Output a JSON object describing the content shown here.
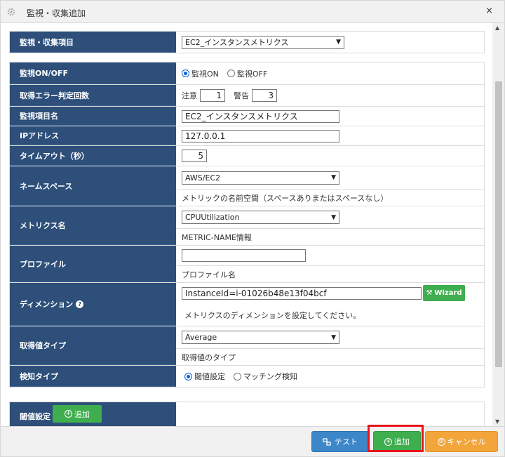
{
  "window": {
    "title": "監視・収集追加",
    "close_glyph": "×"
  },
  "fields": {
    "monitor_item": {
      "label": "監視・収集項目",
      "value": "EC2_インスタンスメトリクス"
    },
    "monitor_onoff": {
      "label": "監視ON/OFF",
      "on_label": "監視ON",
      "off_label": "監視OFF",
      "selected": "on"
    },
    "error_count": {
      "label": "取得エラー判定回数",
      "warn_label": "注意",
      "warn_value": "1",
      "alert_label": "警告",
      "alert_value": "3"
    },
    "item_name": {
      "label": "監視項目名",
      "value": "EC2_インスタンスメトリクス"
    },
    "ip_address": {
      "label": "IPアドレス",
      "value": "127.0.0.1"
    },
    "timeout": {
      "label": "タイムアウト（秒）",
      "value": "5"
    },
    "namespace": {
      "label": "ネームスペース",
      "value": "AWS/EC2",
      "help": "メトリックの名前空間（スペースありまたはスペースなし）"
    },
    "metrics_name": {
      "label": "メトリクス名",
      "value": "CPUUtilization",
      "help": "METRIC-NAME情報"
    },
    "profile": {
      "label": "プロファイル",
      "value": "",
      "help": "プロファイル名"
    },
    "dimension": {
      "label": "ディメンション",
      "value": "InstanceId=i-01026b48e13f04bcf",
      "wizard_label": "Wizard",
      "help": "メトリクスのディメンションを設定してください。"
    },
    "value_type": {
      "label": "取得値タイプ",
      "value": "Average",
      "help": "取得値のタイプ"
    },
    "detect_type": {
      "label": "検知タイプ",
      "threshold_label": "閾値設定",
      "matching_label": "マッチング検知",
      "selected": "threshold"
    },
    "threshold": {
      "label": "閾値設定",
      "add_label": "追加"
    }
  },
  "footer": {
    "test_label": "テスト",
    "add_label": "追加",
    "cancel_label": "キャンセル"
  },
  "colors": {
    "label_bg": "#2d4f7a",
    "green": "#3fae4f",
    "blue": "#3d87c8",
    "orange": "#f2a53b",
    "highlight": "#e8141a"
  }
}
